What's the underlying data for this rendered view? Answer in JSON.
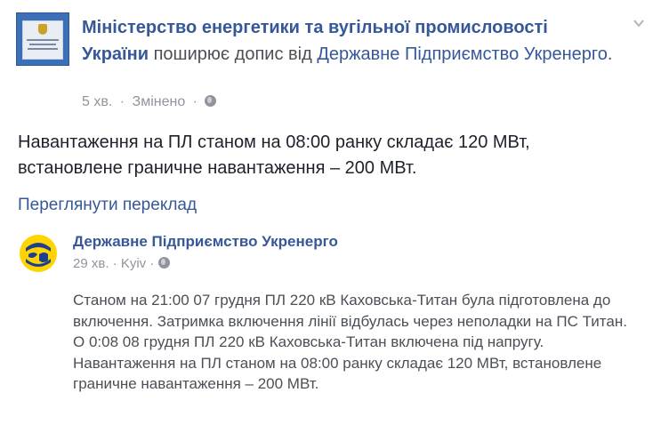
{
  "post": {
    "page_name": "Міністерство енергетики та вугільної промисловості України",
    "shares_text": "поширює допис від",
    "shared_page_name": "Державне Підприємство Укренерго",
    "period": ".",
    "time": "5 хв.",
    "separator": "·",
    "edited": "Змінено",
    "menu_icon": "chevron-down-icon",
    "privacy_icon": "globe-icon",
    "text_line1": "Навантаження на ПЛ станом на 08:00 ранку складає 120 МВт,",
    "text_line2": "встановлене граничне навантаження – 200 МВт.",
    "see_translation": "Переглянути переклад"
  },
  "shared_post": {
    "page_name": "Державне Підприємство Укренерго",
    "time": "29 хв.",
    "separator": "·",
    "location": "Kyiv",
    "privacy_icon": "globe-icon",
    "paragraph1": "Станом на 21:00 07 грудня ПЛ 220 кВ Каховська-Титан була підготовлена до включення. Затримка включення лінії відбулась через неполадки на ПС Титан.",
    "paragraph2": "О 0:08 08 грудня ПЛ 220 кВ Каховська-Титан включена під напругу.",
    "paragraph3": "Навантаження на ПЛ станом на 08:00 ранку складає 120 МВт, встановлене граничне навантаження – 200 МВт."
  },
  "colors": {
    "link": "#365899",
    "meta": "#90949c",
    "text": "#1d2129",
    "shared_text": "#4b4f56"
  }
}
